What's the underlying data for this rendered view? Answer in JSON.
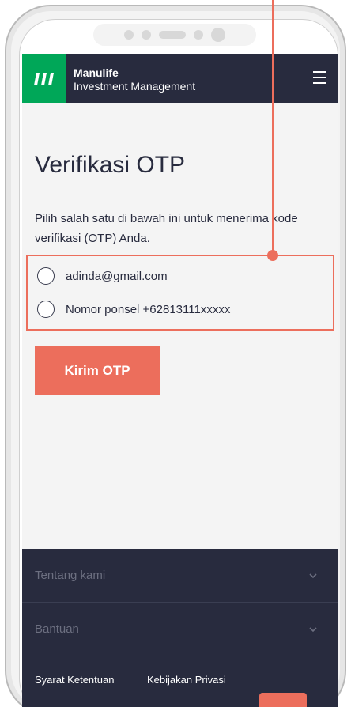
{
  "header": {
    "brand_name": "Manulife",
    "brand_sub": "Investment Management"
  },
  "main": {
    "title": "Verifikasi OTP",
    "description": "Pilih salah satu di bawah ini untuk menerima kode verifikasi (OTP) Anda.",
    "options": [
      {
        "label": "adinda@gmail.com",
        "selected": false
      },
      {
        "label": "Nomor ponsel +62813111xxxxx",
        "selected": false
      }
    ],
    "send_button": "Kirim OTP"
  },
  "footer": {
    "accordion": [
      {
        "label": "Tentang kami"
      },
      {
        "label": "Bantuan"
      }
    ],
    "links": [
      "Syarat Ketentuan",
      "Kebijakan Privasi"
    ]
  },
  "colors": {
    "header_bg": "#282b3e",
    "logo_green": "#00a758",
    "accent_coral": "#ec6e5c",
    "screen_bg": "#f4f4f4"
  },
  "icons": {
    "logo": "manulife-logo-icon",
    "menu": "hamburger-menu-icon",
    "accordion": "chevron-down-icon"
  }
}
